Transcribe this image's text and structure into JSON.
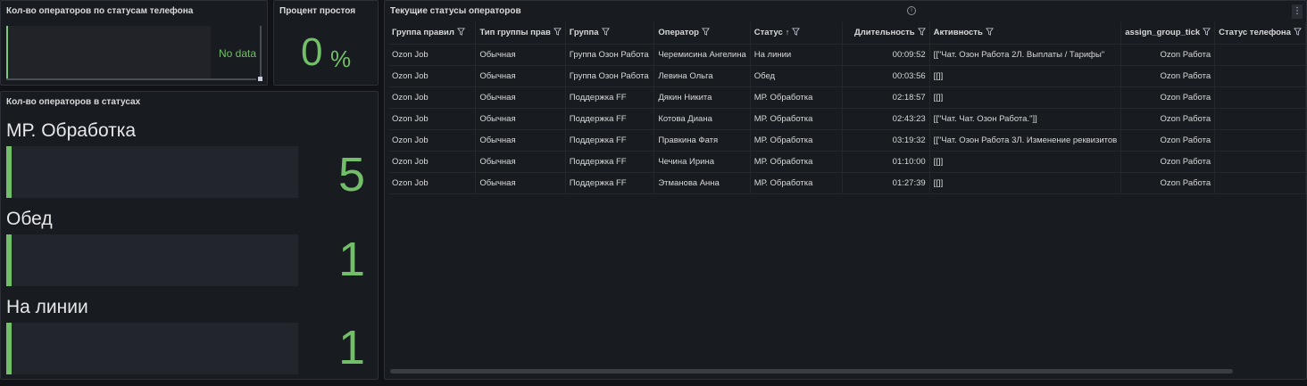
{
  "panels": {
    "phone_status": {
      "title": "Кол-во операторов по статусам телефона",
      "no_data": "No data"
    },
    "idle_percent": {
      "title": "Процент простоя",
      "value": "0",
      "unit": "%"
    },
    "status_counts": {
      "title": "Кол-во операторов в статусах",
      "accent": "#73bf69",
      "items": [
        {
          "name": "МР. Обработка",
          "value": "5",
          "fill": 0.01
        },
        {
          "name": "Обед",
          "value": "1",
          "fill": 0.005
        },
        {
          "name": "На линии",
          "value": "1",
          "fill": 0.005
        }
      ]
    },
    "operators_table": {
      "title": "Текущие статусы операторов",
      "columns": [
        "Группа правил",
        "Тип группы прав",
        "Группа",
        "Оператор",
        "Статус",
        "Длительность",
        "Активность",
        "assign_group_tick",
        "Статус телефона"
      ],
      "rows": [
        [
          "Ozon Job",
          "Обычная",
          "Группа Озон Работа",
          "Черемисина Ангелина",
          "На линии",
          "00:09:52",
          "[[\"Чат. Озон Работа 2Л. Выплаты / Тарифы\"",
          "Ozon Работа",
          ""
        ],
        [
          "Ozon Job",
          "Обычная",
          "Группа Озон Работа",
          "Левина Ольга",
          "Обед",
          "00:03:56",
          "[[]]",
          "Ozon Работа",
          ""
        ],
        [
          "Ozon Job",
          "Обычная",
          "Поддержка FF",
          "Дякин Никита",
          "МР. Обработка",
          "02:18:57",
          "[[]]",
          "Ozon Работа",
          ""
        ],
        [
          "Ozon Job",
          "Обычная",
          "Поддержка FF",
          "Котова Диана",
          "МР. Обработка",
          "02:43:23",
          "[[\"Чат. Чат. Озон Работа.\"]]",
          "Ozon Работа",
          ""
        ],
        [
          "Ozon Job",
          "Обычная",
          "Поддержка FF",
          "Правкина Фатя",
          "МР. Обработка",
          "03:19:32",
          "[[\"Чат. Озон Работа 3Л. Изменение реквизитов",
          "Ozon Работа",
          ""
        ],
        [
          "Ozon Job",
          "Обычная",
          "Поддержка FF",
          "Чечина Ирина",
          "МР. Обработка",
          "01:10:00",
          "[[]]",
          "Ozon Работа",
          ""
        ],
        [
          "Ozon Job",
          "Обычная",
          "Поддержка FF",
          "Этманова Анна",
          "МР. Обработка",
          "01:27:39",
          "[[]]",
          "Ozon Работа",
          ""
        ]
      ]
    }
  }
}
